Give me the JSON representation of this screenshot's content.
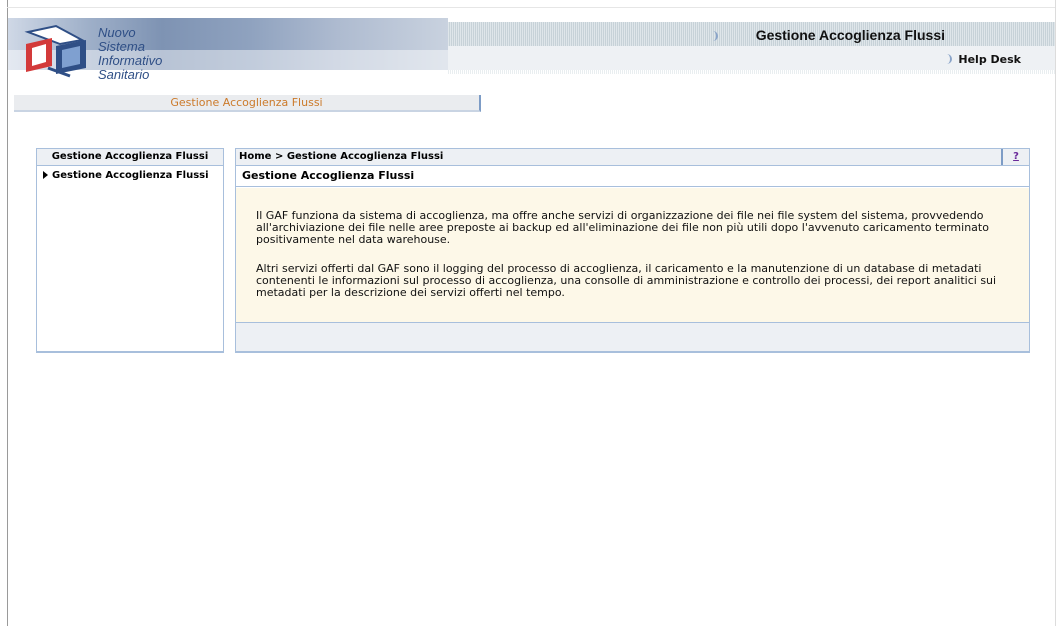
{
  "header": {
    "logo_lines": [
      "Nuovo",
      "Sistema",
      "Informativo",
      "Sanitario"
    ],
    "app_title": "Gestione Accoglienza Flussi",
    "help_label": "Help Desk",
    "subtitle": "Gestione Accoglienza Flussi"
  },
  "sidebar": {
    "title": "Gestione Accoglienza Flussi",
    "items": [
      {
        "label": "Gestione Accoglienza Flussi"
      }
    ]
  },
  "main": {
    "breadcrumb": {
      "home": "Home",
      "separator": ">",
      "current": "Gestione Accoglienza Flussi"
    },
    "help_link": "?",
    "section_title": "Gestione Accoglienza Flussi",
    "paragraphs": [
      "Il GAF funziona da sistema di accoglienza, ma offre anche servizi di organizzazione dei file nei file system del sistema, provvedendo all'archiviazione dei file nelle aree preposte ai backup ed all'eliminazione dei file non più utili dopo l'avvenuto caricamento terminato positivamente nel data warehouse.",
      "Altri servizi offerti dal GAF sono il logging del processo di accoglienza, il caricamento e la manutenzione di un database di metadati contenenti le informazioni sul processo di accoglienza, una consolle di amministrazione e controllo dei processi, dei report analitici sui metadati per la descrizione dei servizi offerti nel tempo."
    ]
  },
  "icons": {
    "logo": "nsis-logo-icon",
    "decor": "crescent-icon",
    "menu_arrow": "triangle-right-icon"
  },
  "colors": {
    "panel_border": "#a8bfdc",
    "panel_header_bg": "#edf0f4",
    "content_bg": "#fdf8e8",
    "subtitle_text": "#cc7a2a",
    "help_link": "#6a2a9a",
    "logo_text": "#2f4f86"
  }
}
